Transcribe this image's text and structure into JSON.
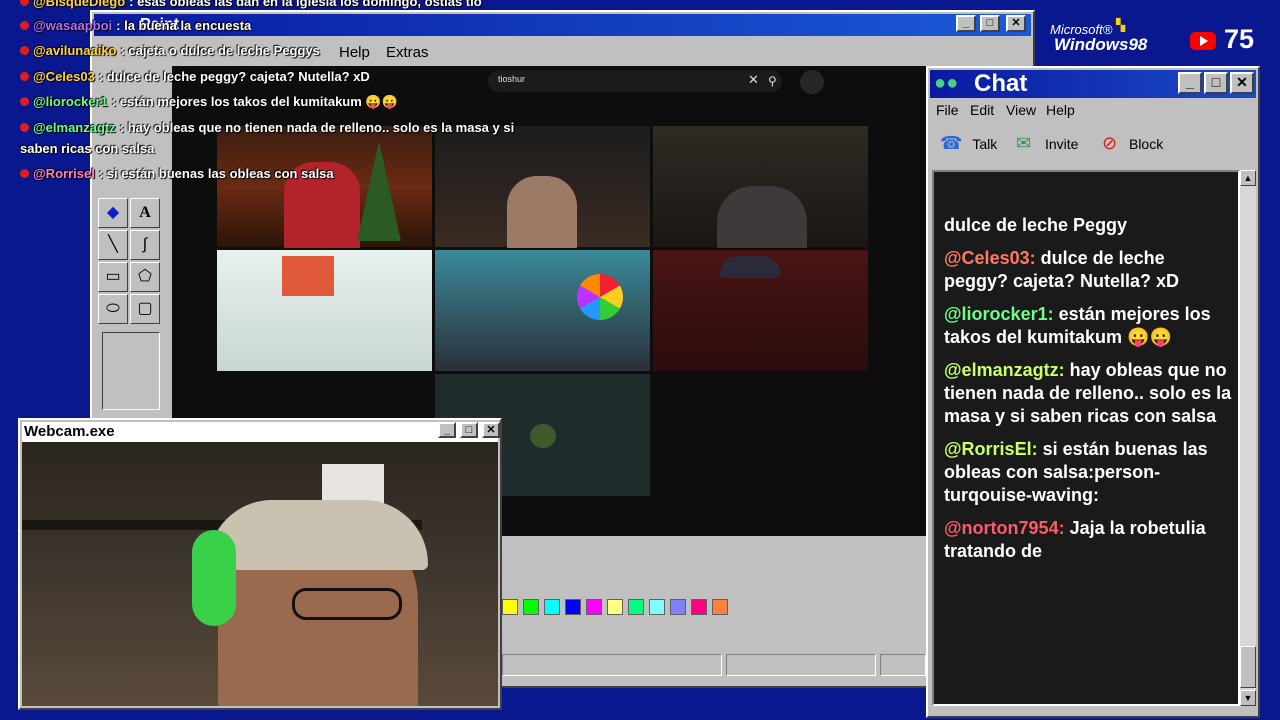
{
  "paint": {
    "title": "Paint",
    "menu": [
      "Help",
      "Extras"
    ],
    "palette": [
      "#ffff00",
      "#00ff00",
      "#00ffff",
      "#0000ff",
      "#ff00ff",
      "#ffff80",
      "#00ff80",
      "#80ffff",
      "#8080ff",
      "#ff0080",
      "#ff8040"
    ]
  },
  "browser": {
    "search_value": "tioshur"
  },
  "webcam": {
    "title": "Webcam.exe"
  },
  "overlay": {
    "win_logo_ms": "Microsoft®",
    "win_logo_name": "Windows98",
    "viewer_count": "75"
  },
  "stream_chat": [
    {
      "user": "@BisqueDiego",
      "text": ": esas obleas las dan en la iglesia los domingo, ostias  tio",
      "color": "#ffd24a"
    },
    {
      "user": "@wasaapboi",
      "text": ": la buena la encuesta",
      "color": "#b56cff"
    },
    {
      "user": "@avilunaaiko",
      "text": ": cajeta o dulce de leche Peggys",
      "color": "#ffd24a"
    },
    {
      "user": "@Celes03",
      "text": ": dulce de leche peggy? cajeta? Nutella? xD",
      "color": "#ffd24a"
    },
    {
      "user": "@liorocker1",
      "text": ": están mejores los takos del kumitakum 😛😛",
      "color": "#6dff8a"
    },
    {
      "user": "@elmanzagtz",
      "text": ": hay obleas que no tienen nada de relleno.. solo es la masa y si",
      "text2": "saben ricas con salsa",
      "color": "#6dff8a"
    },
    {
      "user": "@Rorrisel",
      "text": ": si están buenas las obleas con salsa",
      "color": "#ff7fbf"
    }
  ],
  "chat_window": {
    "title": "Chat",
    "menu": [
      "File",
      "Edit",
      "View",
      "Help"
    ],
    "toolbar": [
      "Talk",
      "Invite",
      "Block"
    ],
    "messages": [
      {
        "user": "",
        "text": "dulce de leche Peggy",
        "color": "#ffffff"
      },
      {
        "user": "@Celes03:",
        "text": "dulce de leche peggy? cajeta? Nutella? xD",
        "color": "#ff7a66"
      },
      {
        "user": "@liorocker1:",
        "text": "están mejores los takos del kumitakum 😛😛",
        "color": "#6dff8a"
      },
      {
        "user": "@elmanzagtz:",
        "text": "hay obleas que no tienen nada de relleno.. solo es la masa y si saben ricas con salsa",
        "color": "#c8ff6a"
      },
      {
        "user": "@RorrisEl:",
        "text": "si están buenas las obleas con salsa:person-turqouise-waving:",
        "color": "#c8ff6a"
      },
      {
        "user": "@norton7954:",
        "text": "Jaja la robetulia tratando de",
        "color": "#ff5a6a"
      }
    ]
  }
}
